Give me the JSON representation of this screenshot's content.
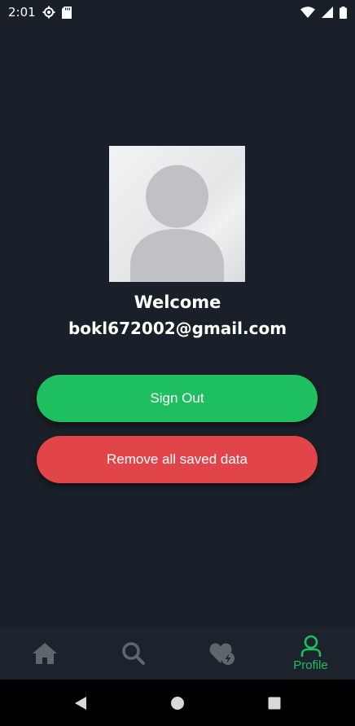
{
  "status_bar": {
    "time": "2:01",
    "icons": [
      "settings-gear-icon",
      "sd-card-icon",
      "wifi-icon",
      "signal-icon",
      "battery-icon"
    ]
  },
  "profile": {
    "avatar_icon": "default-user-avatar",
    "welcome": "Welcome",
    "email": "bokl672002@gmail.com"
  },
  "actions": {
    "sign_out_label": "Sign Out",
    "remove_data_label": "Remove all saved data"
  },
  "bottom_nav": {
    "items": [
      {
        "icon": "home-icon",
        "label": "",
        "active": false
      },
      {
        "icon": "search-icon",
        "label": "",
        "active": false
      },
      {
        "icon": "favorites-heart-bolt-icon",
        "label": "",
        "active": false
      },
      {
        "icon": "profile-icon",
        "label": "Profile",
        "active": true
      }
    ]
  },
  "system_nav": {
    "icons": [
      "back-icon",
      "home-circle-icon",
      "recents-square-icon"
    ]
  },
  "colors": {
    "background": "#1a2029",
    "accent_green": "#1dbf5f",
    "danger_red": "#e1454a",
    "nav_icon_inactive": "#5f666e"
  }
}
